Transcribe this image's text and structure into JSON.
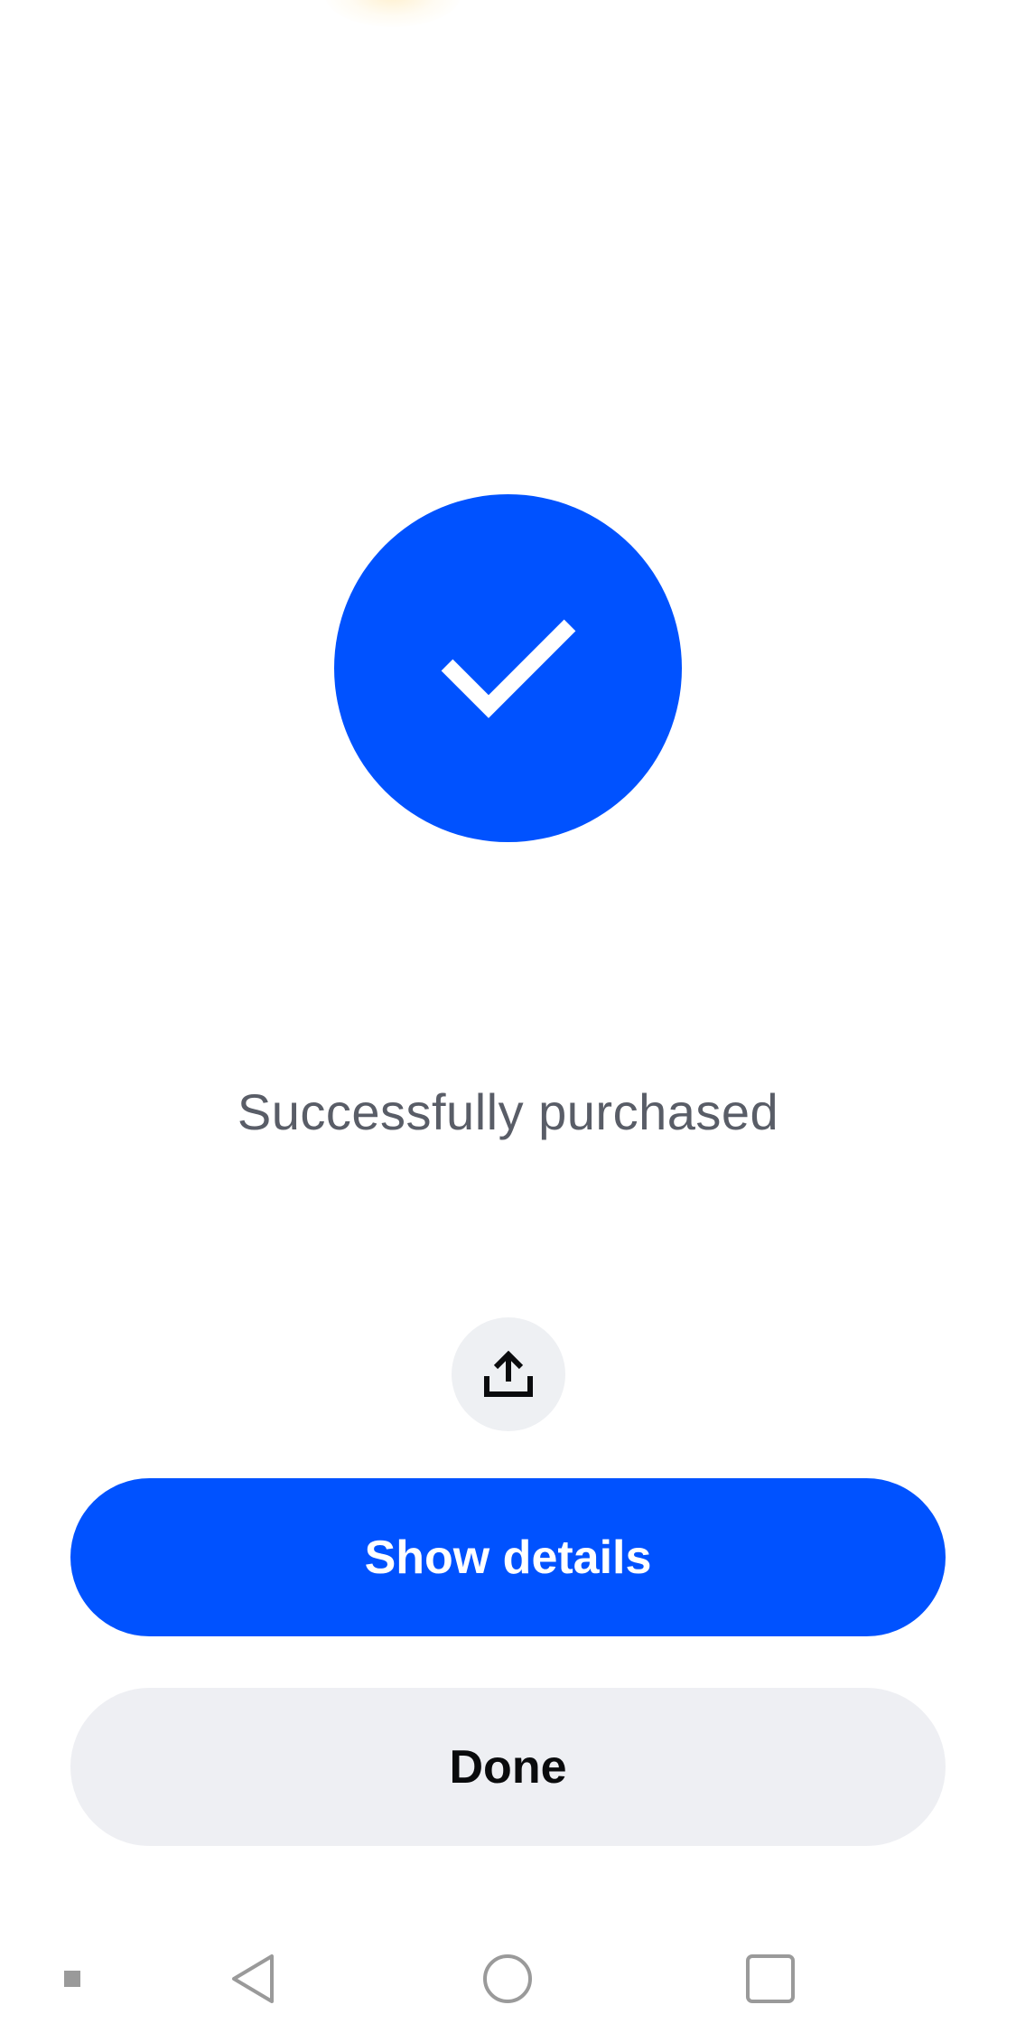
{
  "status": {
    "message": "Successfully purchased",
    "icon": "checkmark-icon"
  },
  "actions": {
    "share_icon": "share-upload-icon",
    "show_details_label": "Show details",
    "done_label": "Done"
  },
  "navigation": {
    "items": [
      "menu-indicator-icon",
      "back-icon",
      "home-icon",
      "recents-icon"
    ]
  },
  "colors": {
    "accent": "#0052ff",
    "secondary_button": "#eeeff3",
    "status_text": "#595d67"
  }
}
